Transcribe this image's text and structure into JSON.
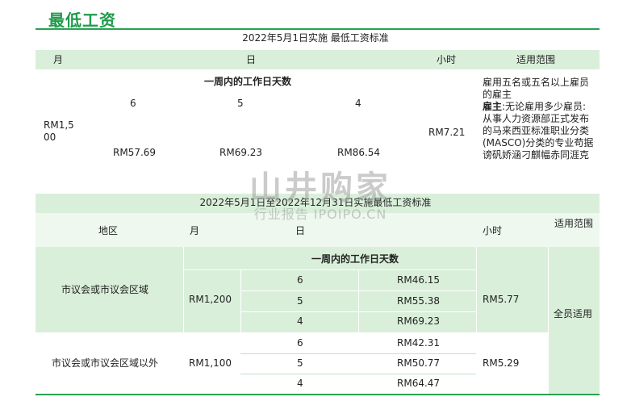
{
  "page_title": "最低工资",
  "table1": {
    "caption": "2022年5月1日实施 最低工资标准",
    "headers": {
      "month": "月",
      "day": "日",
      "hour": "小时",
      "scope": "适用范围"
    },
    "workdays_title": "一周内的工作日天数",
    "day_counts": [
      "6",
      "5",
      "4"
    ],
    "month_value": "RM1,500",
    "day_values": [
      "RM57.69",
      "RM69.23",
      "RM86.54"
    ],
    "hour_value": "RM7.21",
    "scope_line1": "雇用五名或五名以上雇员的雇主",
    "scope_bold": "雇主",
    "scope_rest": ":无论雇用多少雇员:从事人力资源部正式发布的马来西亚标准职业分类(MASCO)分类的专业苟据谤矾娇涵刁麒幅赤同涯克"
  },
  "table2": {
    "caption": "2022年5月1日至2022年12月31日实施最低工资标准",
    "headers": {
      "region": "地区",
      "month": "月",
      "day": "日",
      "hour": "小时",
      "scope": "适用范围"
    },
    "workdays_title": "一周内的工作日天数",
    "scope_all": "全员适用",
    "rows": [
      {
        "region": "市议会或市议会区域",
        "month": "RM1,200",
        "hour": "RM5.77",
        "days": [
          {
            "count": "6",
            "rate": "RM46.15"
          },
          {
            "count": "5",
            "rate": "RM55.38"
          },
          {
            "count": "4",
            "rate": "RM69.23"
          }
        ]
      },
      {
        "region": "市议会或市议会区域以外",
        "month": "RM1,100",
        "hour": "RM5.29",
        "days": [
          {
            "count": "6",
            "rate": "RM42.31"
          },
          {
            "count": "5",
            "rate": "RM50.77"
          },
          {
            "count": "4",
            "rate": "RM64.47"
          }
        ]
      }
    ]
  },
  "watermark": {
    "line1": "山井购家",
    "line2": "行业报告 IPOIPO.CN"
  }
}
